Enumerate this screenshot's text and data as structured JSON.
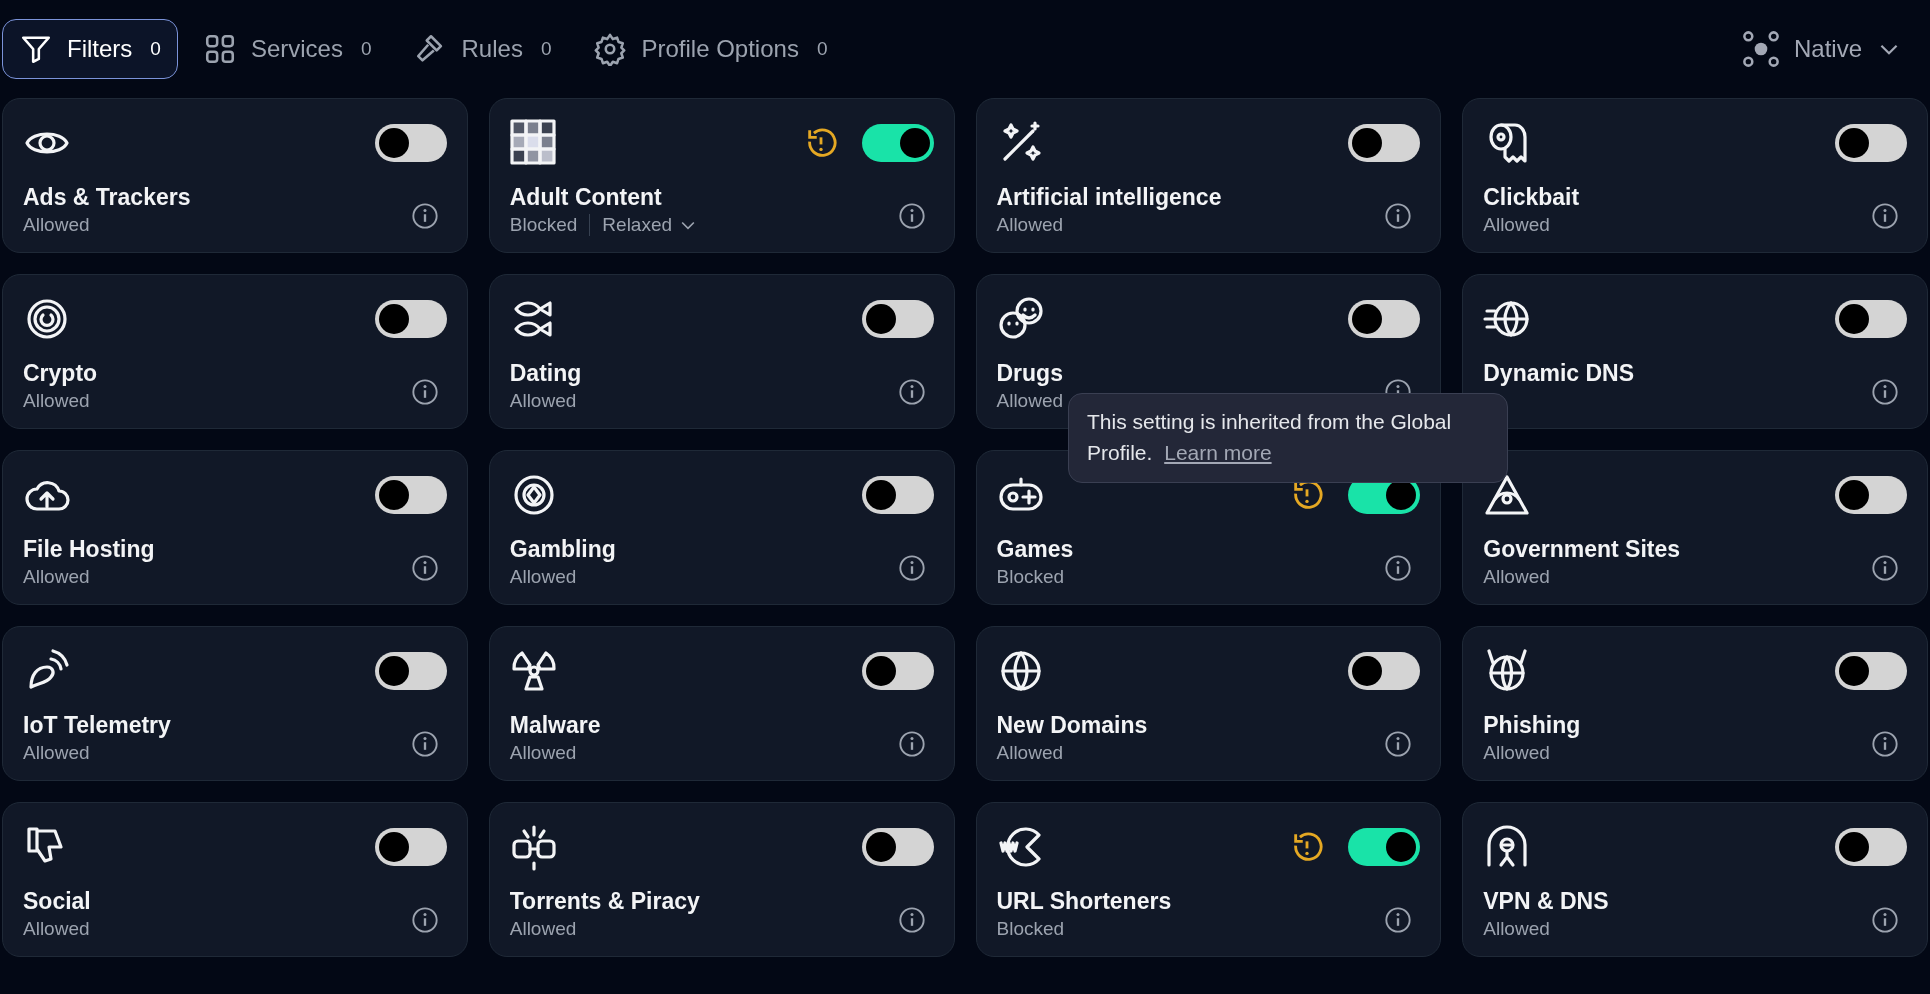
{
  "tabs": [
    {
      "label": "Filters",
      "count": "0",
      "selected": true
    },
    {
      "label": "Services",
      "count": "0",
      "selected": false
    },
    {
      "label": "Rules",
      "count": "0",
      "selected": false
    },
    {
      "label": "Profile Options",
      "count": "0",
      "selected": false
    }
  ],
  "mode_dropdown": {
    "label": "Native"
  },
  "filters": [
    {
      "title": "Ads & Trackers",
      "status": "Allowed",
      "on": false,
      "inherited": false
    },
    {
      "title": "Adult Content",
      "status": "Blocked",
      "level_option": "Relaxed",
      "on": true,
      "inherited": true
    },
    {
      "title": "Artificial intelligence",
      "status": "Allowed",
      "on": false,
      "inherited": false
    },
    {
      "title": "Clickbait",
      "status": "Allowed",
      "on": false,
      "inherited": false
    },
    {
      "title": "Crypto",
      "status": "Allowed",
      "on": false,
      "inherited": false
    },
    {
      "title": "Dating",
      "status": "Allowed",
      "on": false,
      "inherited": false
    },
    {
      "title": "Drugs",
      "status": "Allowed",
      "on": false,
      "inherited": false
    },
    {
      "title": "Dynamic DNS",
      "on": false,
      "inherited": false
    },
    {
      "title": "File Hosting",
      "status": "Allowed",
      "on": false,
      "inherited": false
    },
    {
      "title": "Gambling",
      "status": "Allowed",
      "on": false,
      "inherited": false
    },
    {
      "title": "Games",
      "status": "Blocked",
      "on": true,
      "inherited": true
    },
    {
      "title": "Government Sites",
      "status": "Allowed",
      "on": false,
      "inherited": false
    },
    {
      "title": "IoT Telemetry",
      "status": "Allowed",
      "on": false,
      "inherited": false
    },
    {
      "title": "Malware",
      "status": "Allowed",
      "on": false,
      "inherited": false
    },
    {
      "title": "New Domains",
      "status": "Allowed",
      "on": false,
      "inherited": false
    },
    {
      "title": "Phishing",
      "status": "Allowed",
      "on": false,
      "inherited": false
    },
    {
      "title": "Social",
      "status": "Allowed",
      "on": false,
      "inherited": false
    },
    {
      "title": "Torrents & Piracy",
      "status": "Allowed",
      "on": false,
      "inherited": false
    },
    {
      "title": "URL Shorteners",
      "status": "Blocked",
      "on": true,
      "inherited": true
    },
    {
      "title": "VPN & DNS",
      "status": "Allowed",
      "on": false,
      "inherited": false
    }
  ],
  "tooltip": {
    "text": "This setting is inherited from the Global Profile.",
    "link": "Learn more"
  }
}
